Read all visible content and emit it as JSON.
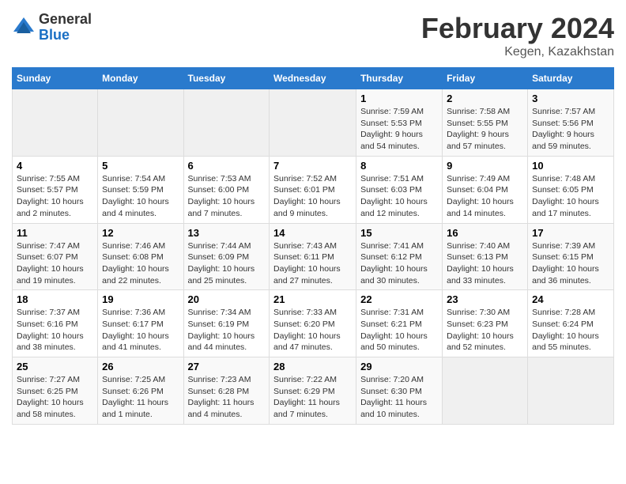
{
  "logo": {
    "general": "General",
    "blue": "Blue"
  },
  "header": {
    "title": "February 2024",
    "subtitle": "Kegen, Kazakhstan"
  },
  "days_of_week": [
    "Sunday",
    "Monday",
    "Tuesday",
    "Wednesday",
    "Thursday",
    "Friday",
    "Saturday"
  ],
  "weeks": [
    [
      {
        "num": "",
        "info": ""
      },
      {
        "num": "",
        "info": ""
      },
      {
        "num": "",
        "info": ""
      },
      {
        "num": "",
        "info": ""
      },
      {
        "num": "1",
        "info": "Sunrise: 7:59 AM\nSunset: 5:53 PM\nDaylight: 9 hours\nand 54 minutes."
      },
      {
        "num": "2",
        "info": "Sunrise: 7:58 AM\nSunset: 5:55 PM\nDaylight: 9 hours\nand 57 minutes."
      },
      {
        "num": "3",
        "info": "Sunrise: 7:57 AM\nSunset: 5:56 PM\nDaylight: 9 hours\nand 59 minutes."
      }
    ],
    [
      {
        "num": "4",
        "info": "Sunrise: 7:55 AM\nSunset: 5:57 PM\nDaylight: 10 hours\nand 2 minutes."
      },
      {
        "num": "5",
        "info": "Sunrise: 7:54 AM\nSunset: 5:59 PM\nDaylight: 10 hours\nand 4 minutes."
      },
      {
        "num": "6",
        "info": "Sunrise: 7:53 AM\nSunset: 6:00 PM\nDaylight: 10 hours\nand 7 minutes."
      },
      {
        "num": "7",
        "info": "Sunrise: 7:52 AM\nSunset: 6:01 PM\nDaylight: 10 hours\nand 9 minutes."
      },
      {
        "num": "8",
        "info": "Sunrise: 7:51 AM\nSunset: 6:03 PM\nDaylight: 10 hours\nand 12 minutes."
      },
      {
        "num": "9",
        "info": "Sunrise: 7:49 AM\nSunset: 6:04 PM\nDaylight: 10 hours\nand 14 minutes."
      },
      {
        "num": "10",
        "info": "Sunrise: 7:48 AM\nSunset: 6:05 PM\nDaylight: 10 hours\nand 17 minutes."
      }
    ],
    [
      {
        "num": "11",
        "info": "Sunrise: 7:47 AM\nSunset: 6:07 PM\nDaylight: 10 hours\nand 19 minutes."
      },
      {
        "num": "12",
        "info": "Sunrise: 7:46 AM\nSunset: 6:08 PM\nDaylight: 10 hours\nand 22 minutes."
      },
      {
        "num": "13",
        "info": "Sunrise: 7:44 AM\nSunset: 6:09 PM\nDaylight: 10 hours\nand 25 minutes."
      },
      {
        "num": "14",
        "info": "Sunrise: 7:43 AM\nSunset: 6:11 PM\nDaylight: 10 hours\nand 27 minutes."
      },
      {
        "num": "15",
        "info": "Sunrise: 7:41 AM\nSunset: 6:12 PM\nDaylight: 10 hours\nand 30 minutes."
      },
      {
        "num": "16",
        "info": "Sunrise: 7:40 AM\nSunset: 6:13 PM\nDaylight: 10 hours\nand 33 minutes."
      },
      {
        "num": "17",
        "info": "Sunrise: 7:39 AM\nSunset: 6:15 PM\nDaylight: 10 hours\nand 36 minutes."
      }
    ],
    [
      {
        "num": "18",
        "info": "Sunrise: 7:37 AM\nSunset: 6:16 PM\nDaylight: 10 hours\nand 38 minutes."
      },
      {
        "num": "19",
        "info": "Sunrise: 7:36 AM\nSunset: 6:17 PM\nDaylight: 10 hours\nand 41 minutes."
      },
      {
        "num": "20",
        "info": "Sunrise: 7:34 AM\nSunset: 6:19 PM\nDaylight: 10 hours\nand 44 minutes."
      },
      {
        "num": "21",
        "info": "Sunrise: 7:33 AM\nSunset: 6:20 PM\nDaylight: 10 hours\nand 47 minutes."
      },
      {
        "num": "22",
        "info": "Sunrise: 7:31 AM\nSunset: 6:21 PM\nDaylight: 10 hours\nand 50 minutes."
      },
      {
        "num": "23",
        "info": "Sunrise: 7:30 AM\nSunset: 6:23 PM\nDaylight: 10 hours\nand 52 minutes."
      },
      {
        "num": "24",
        "info": "Sunrise: 7:28 AM\nSunset: 6:24 PM\nDaylight: 10 hours\nand 55 minutes."
      }
    ],
    [
      {
        "num": "25",
        "info": "Sunrise: 7:27 AM\nSunset: 6:25 PM\nDaylight: 10 hours\nand 58 minutes."
      },
      {
        "num": "26",
        "info": "Sunrise: 7:25 AM\nSunset: 6:26 PM\nDaylight: 11 hours\nand 1 minute."
      },
      {
        "num": "27",
        "info": "Sunrise: 7:23 AM\nSunset: 6:28 PM\nDaylight: 11 hours\nand 4 minutes."
      },
      {
        "num": "28",
        "info": "Sunrise: 7:22 AM\nSunset: 6:29 PM\nDaylight: 11 hours\nand 7 minutes."
      },
      {
        "num": "29",
        "info": "Sunrise: 7:20 AM\nSunset: 6:30 PM\nDaylight: 11 hours\nand 10 minutes."
      },
      {
        "num": "",
        "info": ""
      },
      {
        "num": "",
        "info": ""
      }
    ]
  ]
}
